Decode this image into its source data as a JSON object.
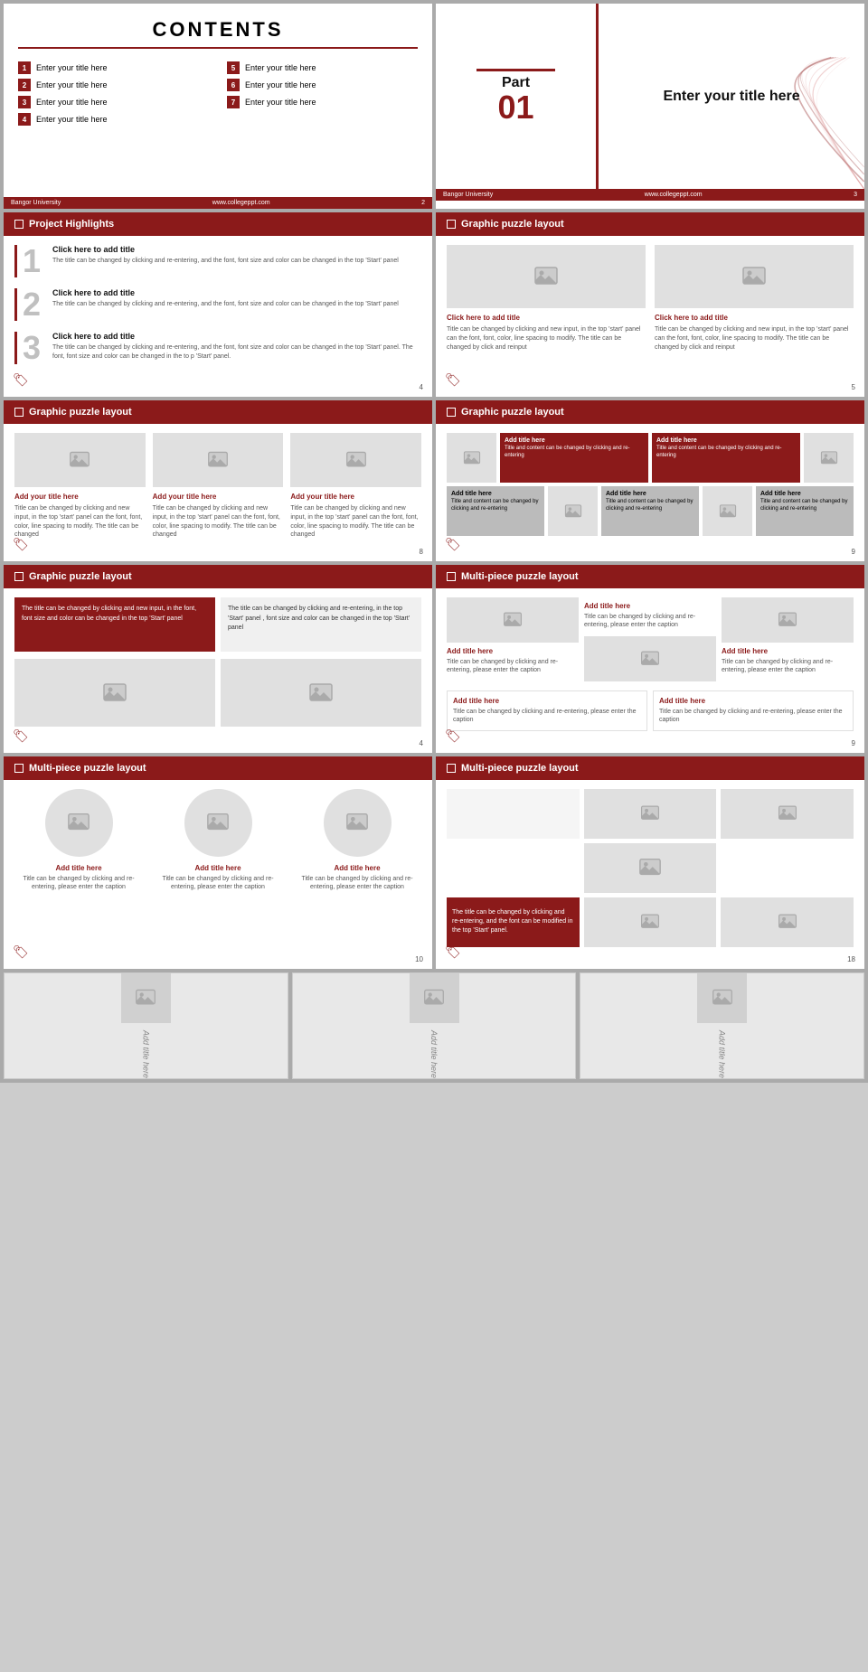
{
  "slides": {
    "slide1": {
      "title": "CONTENTS",
      "items": [
        {
          "num": "1",
          "label": "Enter your title here"
        },
        {
          "num": "2",
          "label": "Enter your title here"
        },
        {
          "num": "3",
          "label": "Enter your title here"
        },
        {
          "num": "4",
          "label": "Enter your title here"
        },
        {
          "num": "5",
          "label": "Enter your title here"
        },
        {
          "num": "6",
          "label": "Enter your title here"
        },
        {
          "num": "7",
          "label": "Enter your title here"
        }
      ],
      "footer_left": "Bangor University",
      "footer_center": "www.collegeppt.com",
      "footer_page": "2"
    },
    "slide2": {
      "part_word": "Part",
      "part_num": "01",
      "title": "Enter your title here",
      "footer_left": "Bangor University",
      "footer_center": "www.collegeppt.com",
      "footer_page": "3"
    },
    "slide3": {
      "header": "Project Highlights",
      "items": [
        {
          "num": "1",
          "title": "Click here to add title",
          "desc": "The title can be changed by clicking and re-entering, and the font, font size and color can be changed in the top 'Start' panel"
        },
        {
          "num": "2",
          "title": "Click here to add title",
          "desc": "The title can be changed by clicking and re-entering, and the font, font size and color can be changed in the top 'Start' panel"
        },
        {
          "num": "3",
          "title": "Click here to add title",
          "desc": "The title can be changed by clicking and re-entering, and the font, font size and color can be changed in the top 'Start' panel. The font, font size and color can be changed in the to p 'Start' panel."
        }
      ],
      "footer_page": "4"
    },
    "slide4": {
      "header": "Graphic puzzle layout",
      "items": [
        {
          "title": "Click here to add title",
          "desc": "Title can be changed by clicking and new input, in the top 'start' panel can the font, font, color, line spacing to modify. The title can be changed by click and reinput"
        },
        {
          "title": "Click here to add title",
          "desc": "Title can be changed by clicking and new input, in the top 'start' panel can the font, font, color, line spacing to modify. The title can be changed by click and reinput"
        }
      ],
      "footer_page": "5"
    },
    "slide5": {
      "header": "Graphic puzzle layout",
      "items": [
        {
          "title": "Add your title here",
          "desc": "Title can be changed by clicking and new input, in the top 'start' panel can the font, font, color, line spacing to modify. The title can be changed"
        },
        {
          "title": "Add your title here",
          "desc": "Title can be changed by clicking and new input, in the top 'start' panel can the font, font, color, line spacing to modify. The title can be changed"
        },
        {
          "title": "Add your title here",
          "desc": "Title can be changed by clicking and new input, in the top 'start' panel can the font, font, color, line spacing to modify. The title can be changed"
        }
      ],
      "footer_page": "8"
    },
    "slide6": {
      "header": "Graphic puzzle layout",
      "cells_top": [
        {
          "label": "Add title here",
          "desc": "Title and content can be changed by clicking and re-entering",
          "dark": true
        },
        {
          "label": "Add title here",
          "desc": "Title and content can be changed by clicking and re-entering",
          "dark": true
        }
      ],
      "cells_bottom": [
        {
          "label": "Add title here",
          "desc": "Title and content can be changed by clicking and re-entering"
        },
        {
          "label": "Add title here",
          "desc": "Title and content can be changed by clicking and re-entering"
        },
        {
          "label": "Add title here",
          "desc": "Title and content can be changed by clicking and re-entering"
        }
      ],
      "footer_page": "9"
    },
    "slide7": {
      "header": "Graphic puzzle layout",
      "text1": "The title can be changed by clicking and new input, in the font, font size and color can be changed in the top 'Start' panel",
      "text2": "The title can be changed by clicking and re-entering, in the top 'Start' panel , font size and color can be changed in the top 'Start' panel",
      "footer_page": "4"
    },
    "slide8": {
      "header": "Multi-piece puzzle layout",
      "items": [
        {
          "title": "Add title here",
          "desc": "Title can be changed by clicking and re-entering, please enter the caption"
        },
        {
          "title": "Add title here",
          "desc": "Title can be changed by clicking and re-entering, please enter the caption"
        },
        {
          "title": "Add title here",
          "desc": "Title can be changed by clicking and re-entering, please enter the caption"
        },
        {
          "title": "Add title here",
          "desc": "Title can be changed by clicking and re-entering, please enter the caption"
        }
      ],
      "footer_page": "9"
    },
    "slide9": {
      "header": "Multi-piece puzzle layout",
      "items": [
        {
          "title": "Add title here",
          "desc": "Title can be changed by clicking and re-entering, please enter the caption"
        },
        {
          "title": "Add title here",
          "desc": "Title can be changed by clicking and re-entering, please enter the caption"
        },
        {
          "title": "Add title here",
          "desc": "Title can be changed by clicking and re-entering, please enter the caption"
        }
      ],
      "footer_page": "10"
    },
    "slide10": {
      "header": "Multi-piece puzzle layout",
      "caption": "The title can be changed by clicking and re-entering, and the font can be modified in the top 'Start' panel.",
      "footer_page": "18"
    }
  },
  "bottom_tiles": [
    {
      "label": "Add title here"
    },
    {
      "label": "Add title here"
    },
    {
      "label": "Add title here"
    }
  ],
  "colors": {
    "primary": "#8b1a1a",
    "light_bg": "#e0e0e0",
    "text_dark": "#222",
    "text_mid": "#555"
  },
  "footer": {
    "university": "Bangor University",
    "website": "www.collegeppt.com"
  }
}
